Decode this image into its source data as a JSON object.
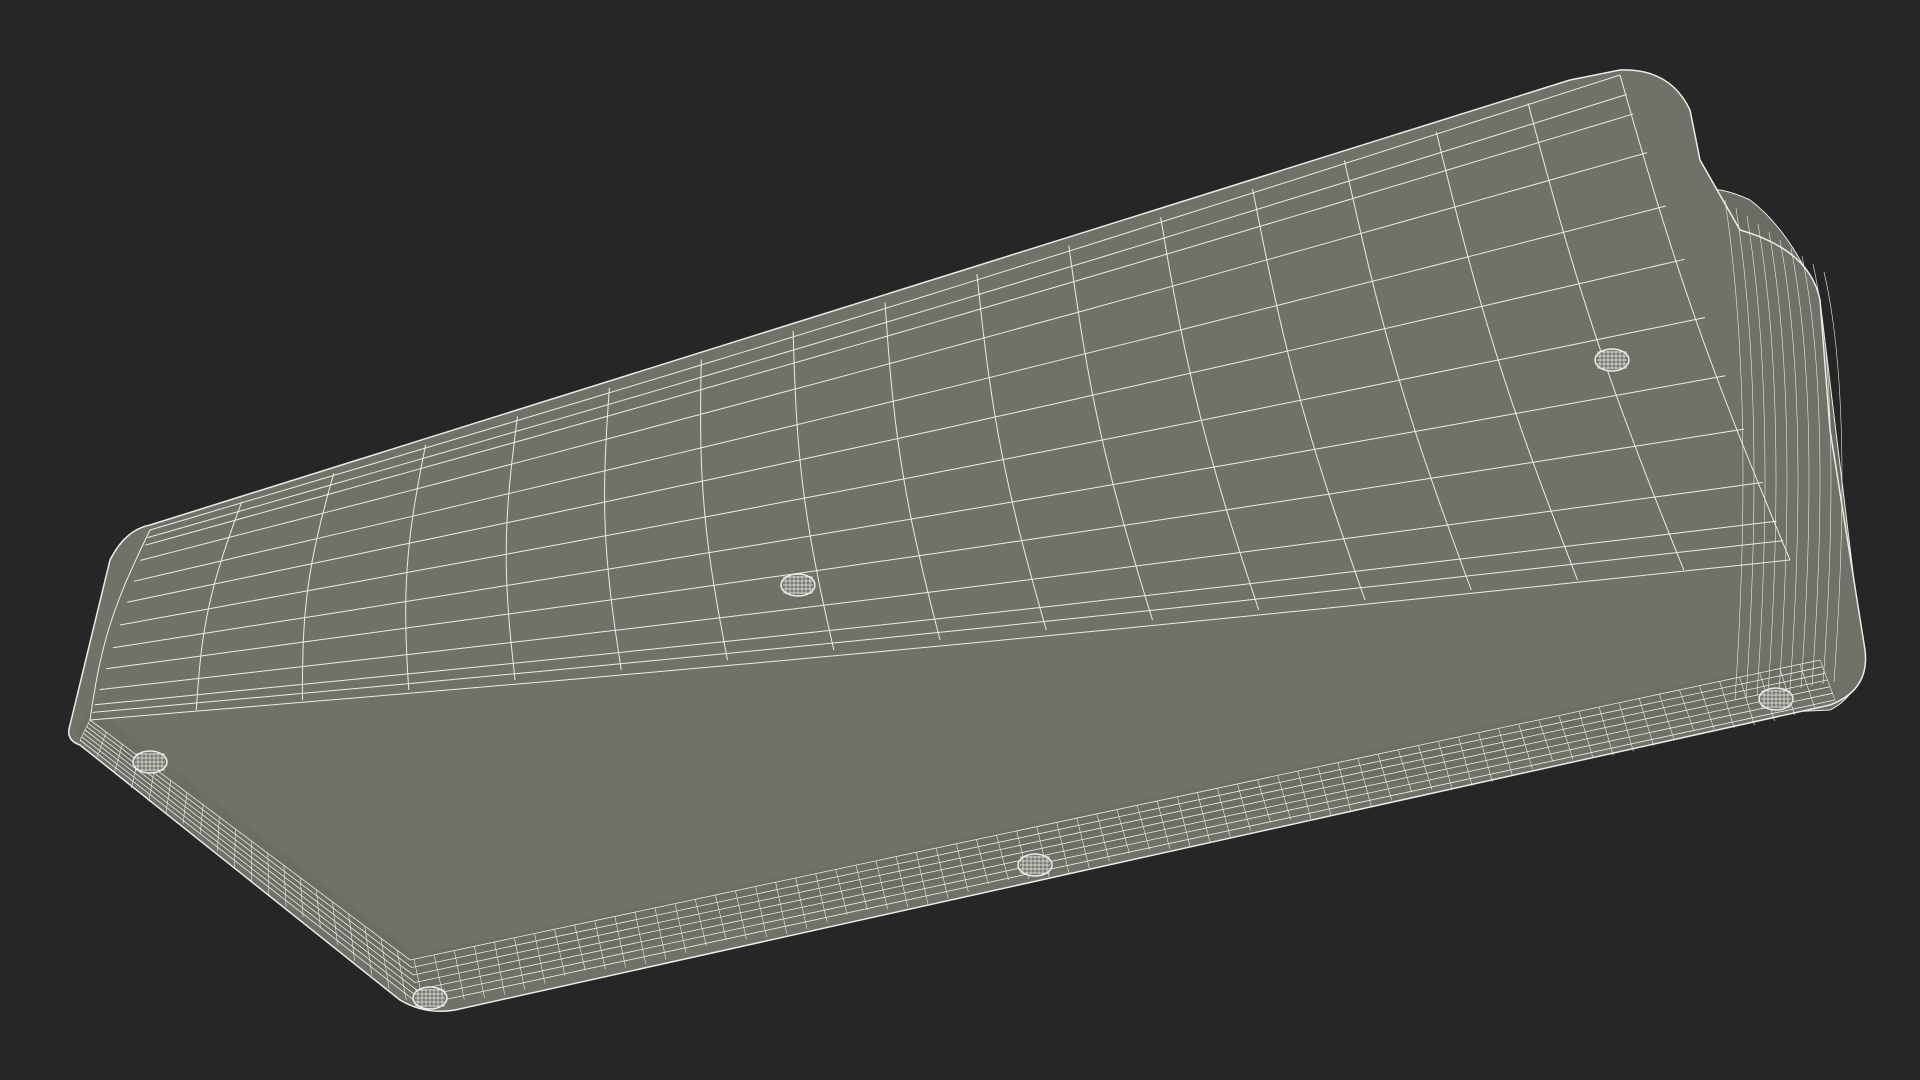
{
  "scene": {
    "background_color": "#262626",
    "surface_color": "#71716a",
    "surface_side_color": "#6b6b64",
    "wire_color": "#ecece6",
    "object_shape": "rounded rectangular block, underside view",
    "render_style": "wireframe over flat shading",
    "feet_count": 6,
    "visible_text": ""
  }
}
